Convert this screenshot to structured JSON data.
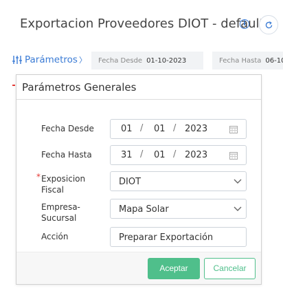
{
  "header": {
    "title": "Exportacion Proveedores DIOT - default",
    "info_icon": "info-icon",
    "refresh_icon": "refresh-icon"
  },
  "filter_bar": {
    "params_label": "Parámetros",
    "params_chevron": "〉",
    "chips": [
      {
        "label": "Fecha Desde",
        "value": "01-10-2023"
      },
      {
        "label": "Fecha Hasta",
        "value": "06-10"
      }
    ]
  },
  "dialog": {
    "title": "Parámetros Generales",
    "fields": {
      "fecha_desde": {
        "label": "Fecha Desde",
        "day": "01",
        "month": "01",
        "year": "2023",
        "sep": "/"
      },
      "fecha_hasta": {
        "label": "Fecha Hasta",
        "day": "31",
        "month": "01",
        "year": "2023",
        "sep": "/"
      },
      "exposicion": {
        "label_line1": "Exposicion",
        "label_line2": "Fiscal",
        "required": "*",
        "value": "DIOT"
      },
      "empresa": {
        "label_line1": "Empresa-",
        "label_line2": "Sucursal",
        "value": "Mapa Solar"
      },
      "accion": {
        "label": "Acción",
        "value": "Preparar Exportación"
      }
    },
    "buttons": {
      "accept": "Aceptar",
      "cancel": "Cancelar"
    }
  },
  "colors": {
    "accent_blue": "#3a7bd5",
    "accent_green": "#4fbf8b",
    "required_red": "#e53935"
  }
}
